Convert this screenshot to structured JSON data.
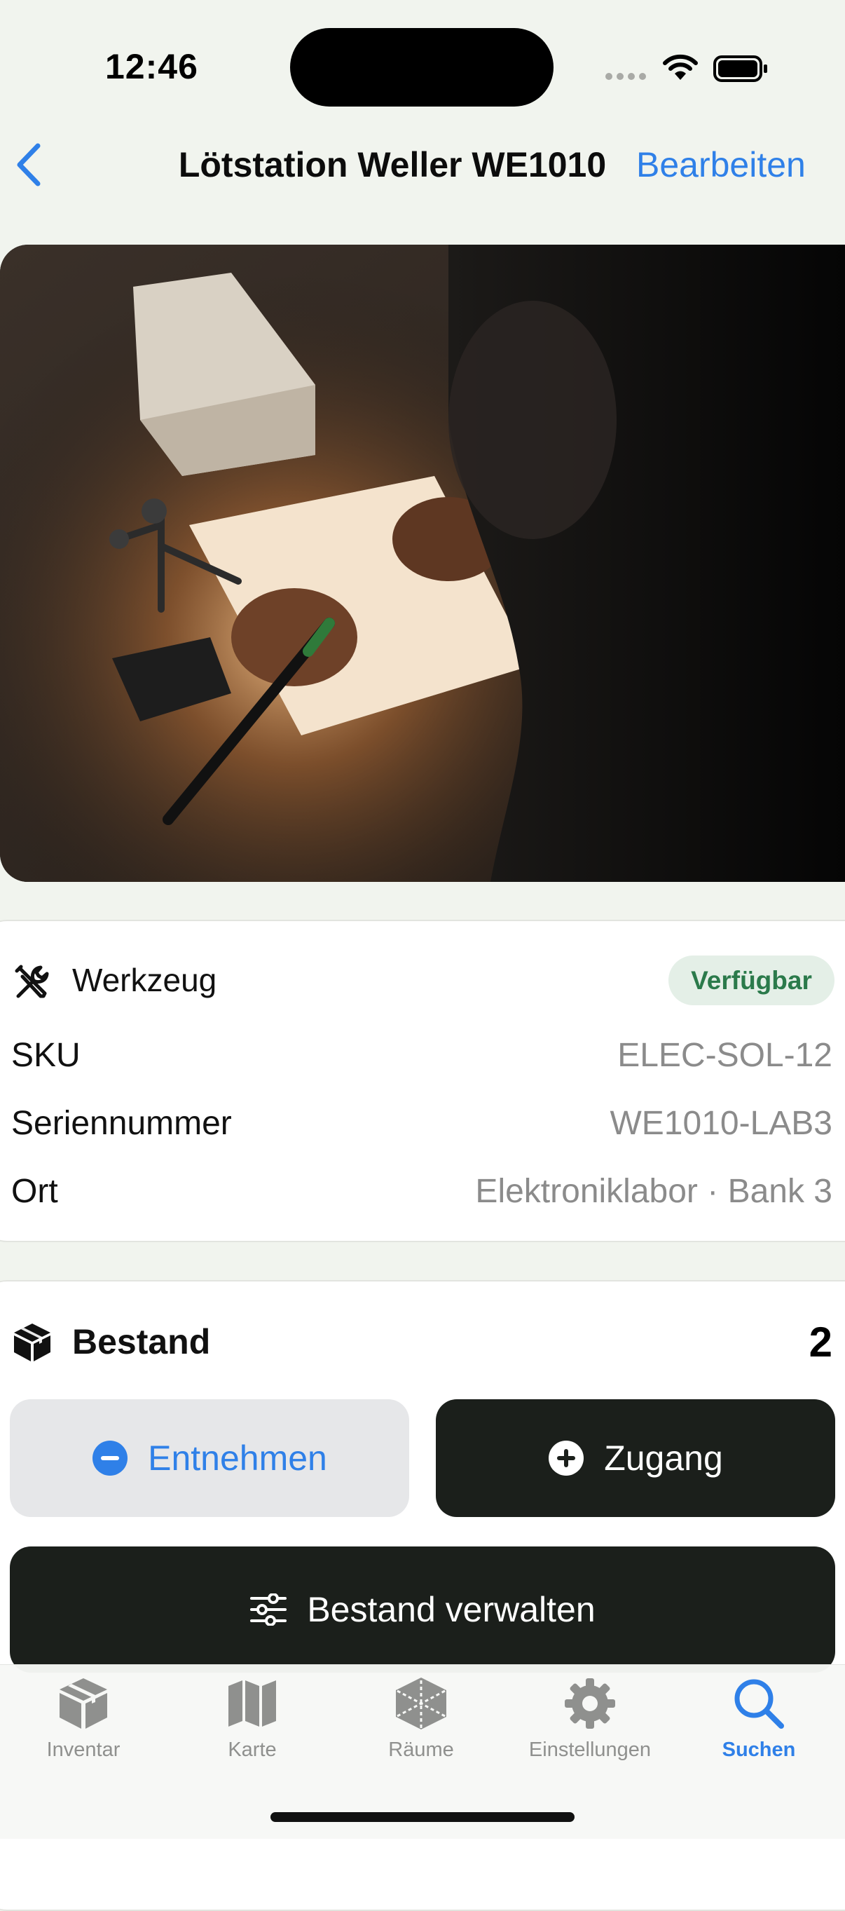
{
  "status_bar": {
    "time": "12:46"
  },
  "nav": {
    "title": "Lötstation Weller WE1010",
    "edit_label": "Bearbeiten",
    "back_icon": "chevron-left-icon"
  },
  "hero_image": {
    "subject": "photo"
  },
  "info_card": {
    "category": "Werkzeug",
    "category_icon": "wrench-screwdriver-icon",
    "status": "Verfügbar",
    "rows": [
      {
        "label": "SKU",
        "value": "ELEC-SOL-12"
      },
      {
        "label": "Seriennummer",
        "value": "WE1010-LAB3"
      },
      {
        "label": "Ort",
        "value": "Elektroniklabor · Bank 3"
      }
    ]
  },
  "stock_card": {
    "title": "Bestand",
    "title_icon": "box-icon",
    "count": "2",
    "remove_label": "Entnehmen",
    "add_label": "Zugang",
    "manage_label": "Bestand verwalten"
  },
  "tabbar": {
    "items": [
      {
        "label": "Inventar",
        "icon": "box-icon"
      },
      {
        "label": "Karte",
        "icon": "map-icon"
      },
      {
        "label": "Räume",
        "icon": "rooms-icon"
      },
      {
        "label": "Einstellungen",
        "icon": "gear-icon"
      },
      {
        "label": "Suchen",
        "icon": "search-icon",
        "active": true
      }
    ]
  },
  "colors": {
    "accent": "#2f80e8",
    "dark_button": "#1b1f1b",
    "badge_green": "#2b7a4b",
    "background": "#f1f4ee"
  }
}
